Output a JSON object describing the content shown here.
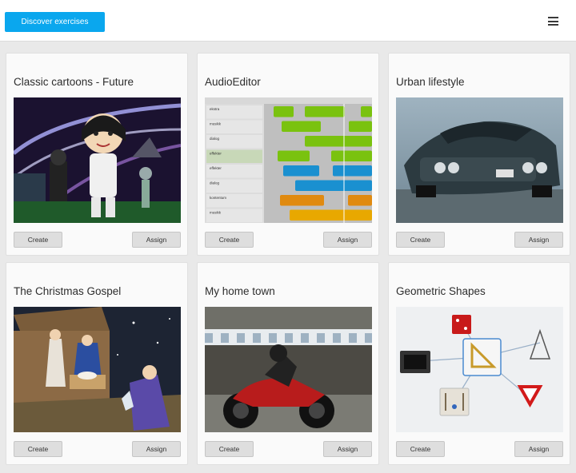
{
  "header": {
    "discover_label": "Discover exercises",
    "menu_icon": "hamburger-menu-icon"
  },
  "colors": {
    "accent": "#0aa7ee",
    "page_bg": "#e9e9e9",
    "card_bg": "#fafafa",
    "button_bg": "#dedede"
  },
  "cards": [
    {
      "title": "Classic cartoons - Future",
      "image": "cartoon-future-image",
      "create_label": "Create",
      "assign_label": "Assign"
    },
    {
      "title": "AudioEditor",
      "image": "audio-editor-image",
      "create_label": "Create",
      "assign_label": "Assign"
    },
    {
      "title": "Urban lifestyle",
      "image": "muscle-car-image",
      "create_label": "Create",
      "assign_label": "Assign"
    },
    {
      "title": "The Christmas Gospel",
      "image": "nativity-cartoon-image",
      "create_label": "Create",
      "assign_label": "Assign"
    },
    {
      "title": "My home town",
      "image": "motorcycle-street-image",
      "create_label": "Create",
      "assign_label": "Assign"
    },
    {
      "title": "Geometric Shapes",
      "image": "geometric-shapes-diagram-image",
      "create_label": "Create",
      "assign_label": "Assign"
    }
  ],
  "audio_editor": {
    "tracks": [
      "ekstra",
      "musikk",
      "dialog",
      "effekter",
      "effekter",
      "dialog",
      "kontentum",
      "musikk"
    ]
  }
}
